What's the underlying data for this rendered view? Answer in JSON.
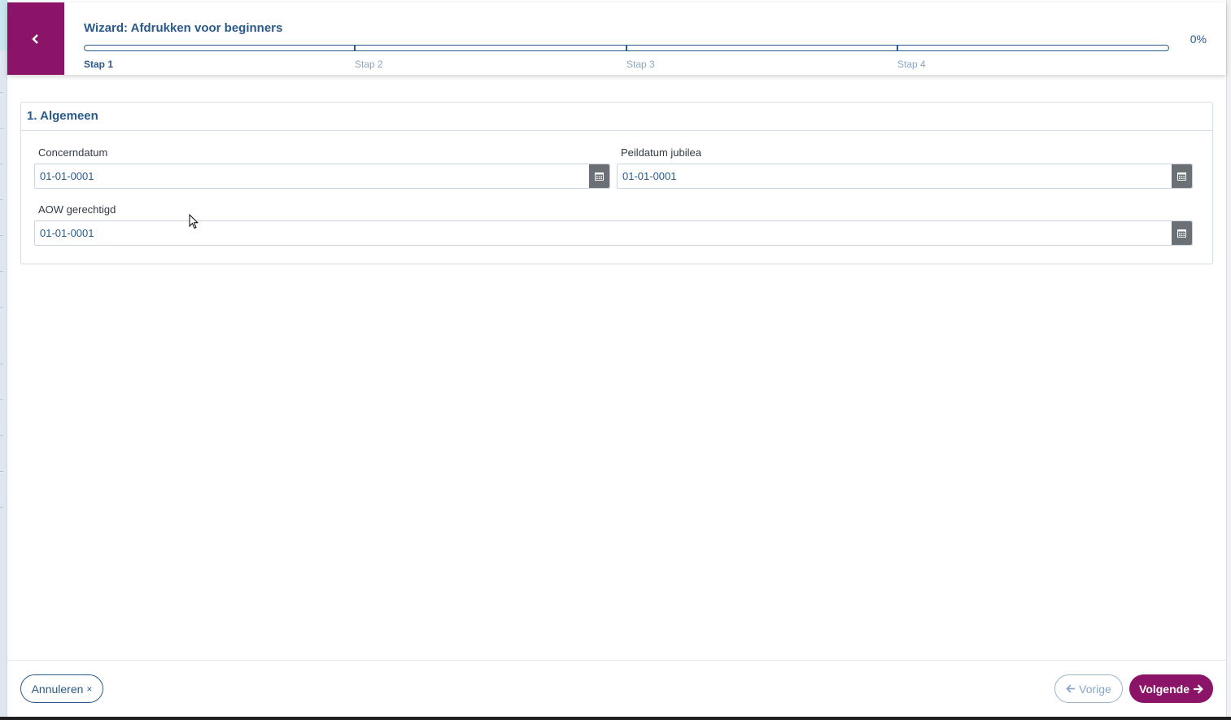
{
  "wizard": {
    "title": "Wizard: Afdrukken voor beginners",
    "progress_percent_label": "0%",
    "progress_value": 0,
    "steps": [
      {
        "label": "Stap 1",
        "active": true
      },
      {
        "label": "Stap 2",
        "active": false
      },
      {
        "label": "Stap 3",
        "active": false
      },
      {
        "label": "Stap 4",
        "active": false
      }
    ]
  },
  "section": {
    "title": "1. Algemeen",
    "fields": {
      "concerndatum": {
        "label": "Concerndatum",
        "value": "01-01-0001"
      },
      "peildatum": {
        "label": "Peildatum jubilea",
        "value": "01-01-0001"
      },
      "aow": {
        "label": "AOW gerechtigd",
        "value": "01-01-0001"
      }
    }
  },
  "footer": {
    "cancel_label": "Annuleren",
    "cancel_icon": "×",
    "prev_label": "Vorige",
    "next_label": "Volgende"
  },
  "colors": {
    "brand": "#8b1468",
    "primary_text": "#2a5a8c",
    "muted": "#8aa6c4"
  }
}
